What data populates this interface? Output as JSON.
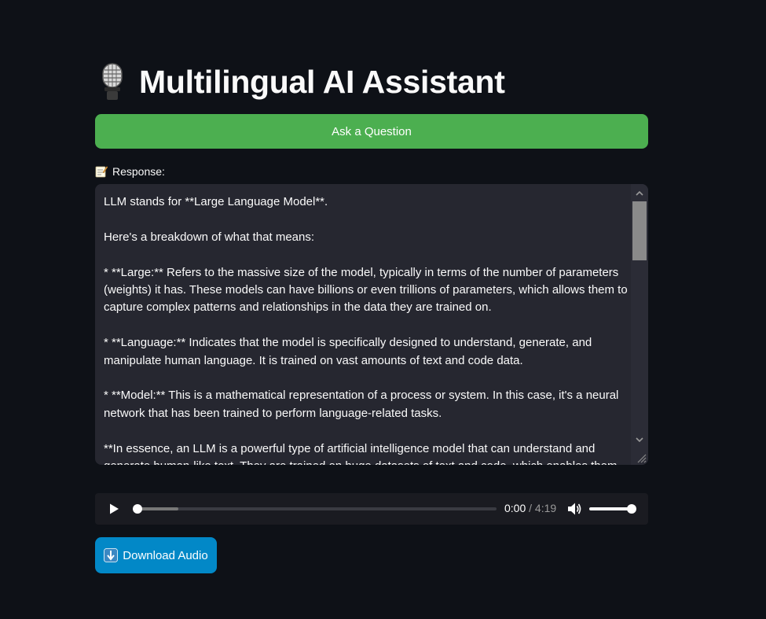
{
  "app": {
    "title": "Multilingual AI Assistant",
    "title_icon": "microphone-icon"
  },
  "ask_button": {
    "label": "Ask a Question",
    "color": "#4caf50"
  },
  "response": {
    "label": "Response:",
    "label_icon": "memo-icon",
    "paragraphs": [
      "LLM stands for **Large Language Model**.",
      "Here's a breakdown of what that means:",
      "*   **Large:** Refers to the massive size of the model, typically in terms of the number of parameters (weights) it has. These models can have billions or even trillions of parameters, which allows them to capture complex patterns and relationships in the data they are trained on.",
      "*   **Language:** Indicates that the model is specifically designed to understand, generate, and manipulate human language. It is trained on vast amounts of text and code data.",
      "*   **Model:** This is a mathematical representation of a process or system. In this case, it's a neural network that has been trained to perform language-related tasks.",
      "**In essence, an LLM is a powerful type of artificial intelligence model that can understand and generate human-like text. They are trained on huge datasets of text and code, which enables them"
    ]
  },
  "audio": {
    "current_time": "0:00",
    "separator": " / ",
    "duration": "4:19",
    "progress": 0.0,
    "volume": 1.0
  },
  "download_button": {
    "label": "Download Audio",
    "icon": "down-arrow-icon",
    "color": "#0288c7"
  }
}
